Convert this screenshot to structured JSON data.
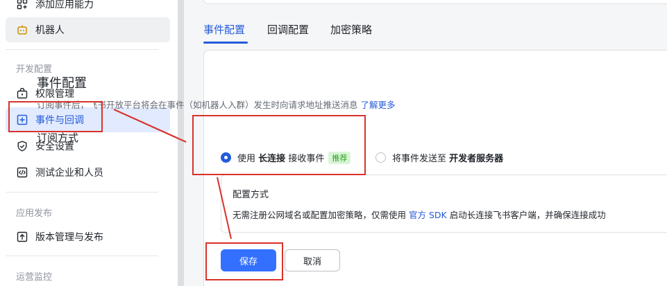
{
  "sidebar": {
    "items_top": [
      {
        "label": "添加应用能力",
        "icon": "grid-add-icon"
      },
      {
        "label": "机器人",
        "icon": "robot-icon"
      }
    ],
    "group_dev": "开发配置",
    "items_dev": [
      {
        "label": "权限管理",
        "icon": "lock-bag-icon"
      },
      {
        "label": "事件与回调",
        "icon": "event-plus-icon"
      },
      {
        "label": "安全设置",
        "icon": "shield-icon"
      },
      {
        "label": "测试企业和人员",
        "icon": "code-icon"
      }
    ],
    "group_publish": "应用发布",
    "items_publish": [
      {
        "label": "版本管理与发布",
        "icon": "upload-icon"
      }
    ],
    "group_ops": "运营监控"
  },
  "tabs": [
    "事件配置",
    "回调配置",
    "加密策略"
  ],
  "card": {
    "title": "事件配置",
    "desc_text": "订阅事件后，飞书开放平台将会在事件（如机器人入群）发生时向请求地址推送消息",
    "desc_link": "了解更多",
    "subscribe_title": "订阅方式",
    "option1": {
      "pre": "使用",
      "bold": "长连接",
      "post": "接收事件",
      "badge": "推荐"
    },
    "option2": {
      "pre": "将事件发送至",
      "bold": "开发者服务器"
    },
    "config_title": "配置方式",
    "config_text_pre": "无需注册公网域名或配置加密策略，仅需使用",
    "config_link": "官方 SDK",
    "config_text_post": "启动长连接飞书客户端，并确保连接成功"
  },
  "buttons": {
    "save": "保存",
    "cancel": "取消"
  },
  "colors": {
    "accent": "#245bdb",
    "primary_button": "#3370ff",
    "annotation": "#d9312a",
    "badge_bg": "#d9f5d6",
    "badge_text": "#2ea121"
  }
}
